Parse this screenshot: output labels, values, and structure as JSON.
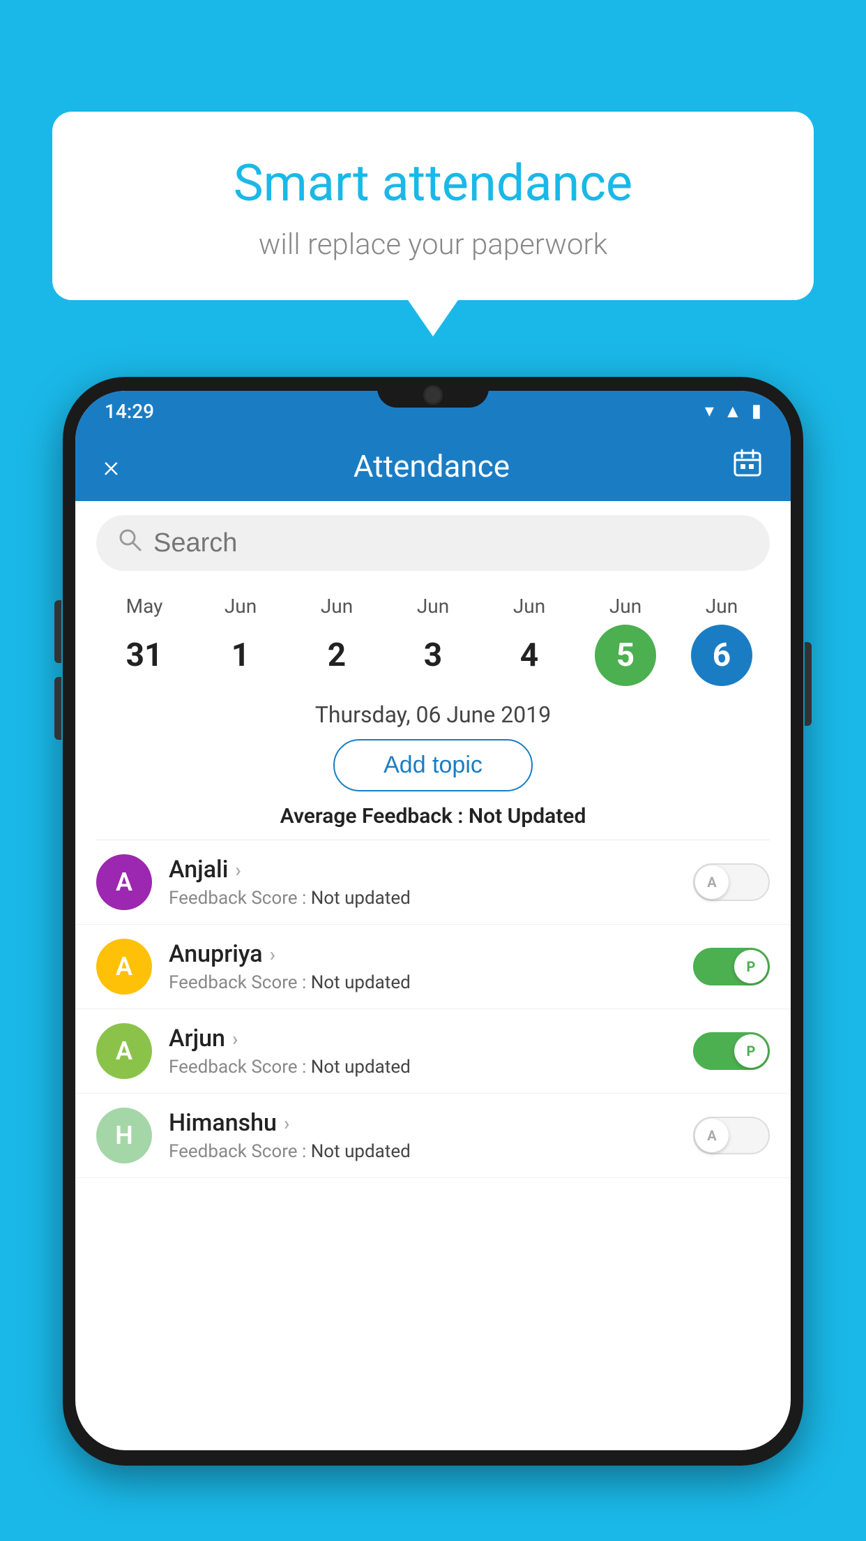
{
  "background_color": "#1ab8e8",
  "bubble": {
    "title": "Smart attendance",
    "subtitle": "will replace your paperwork"
  },
  "status_bar": {
    "time": "14:29",
    "icons": [
      "wifi",
      "signal",
      "battery"
    ]
  },
  "app_bar": {
    "close_label": "×",
    "title": "Attendance",
    "calendar_icon": "📅"
  },
  "search": {
    "placeholder": "Search"
  },
  "calendar": {
    "days": [
      {
        "month": "May",
        "date": "31",
        "style": "normal"
      },
      {
        "month": "Jun",
        "date": "1",
        "style": "normal"
      },
      {
        "month": "Jun",
        "date": "2",
        "style": "normal"
      },
      {
        "month": "Jun",
        "date": "3",
        "style": "normal"
      },
      {
        "month": "Jun",
        "date": "4",
        "style": "normal"
      },
      {
        "month": "Jun",
        "date": "5",
        "style": "today"
      },
      {
        "month": "Jun",
        "date": "6",
        "style": "selected"
      }
    ]
  },
  "selected_date_label": "Thursday, 06 June 2019",
  "add_topic_label": "Add topic",
  "avg_feedback_label": "Average Feedback :",
  "avg_feedback_value": "Not Updated",
  "students": [
    {
      "name": "Anjali",
      "avatar_letter": "A",
      "avatar_color": "#9c27b0",
      "feedback_label": "Feedback Score :",
      "feedback_value": "Not updated",
      "toggle_state": "off",
      "toggle_label": "A"
    },
    {
      "name": "Anupriya",
      "avatar_letter": "A",
      "avatar_color": "#ffc107",
      "feedback_label": "Feedback Score :",
      "feedback_value": "Not updated",
      "toggle_state": "on",
      "toggle_label": "P"
    },
    {
      "name": "Arjun",
      "avatar_letter": "A",
      "avatar_color": "#8bc34a",
      "feedback_label": "Feedback Score :",
      "feedback_value": "Not updated",
      "toggle_state": "on",
      "toggle_label": "P"
    },
    {
      "name": "Himanshu",
      "avatar_letter": "H",
      "avatar_color": "#a5d6a7",
      "feedback_label": "Feedback Score :",
      "feedback_value": "Not updated",
      "toggle_state": "off",
      "toggle_label": "A"
    }
  ]
}
